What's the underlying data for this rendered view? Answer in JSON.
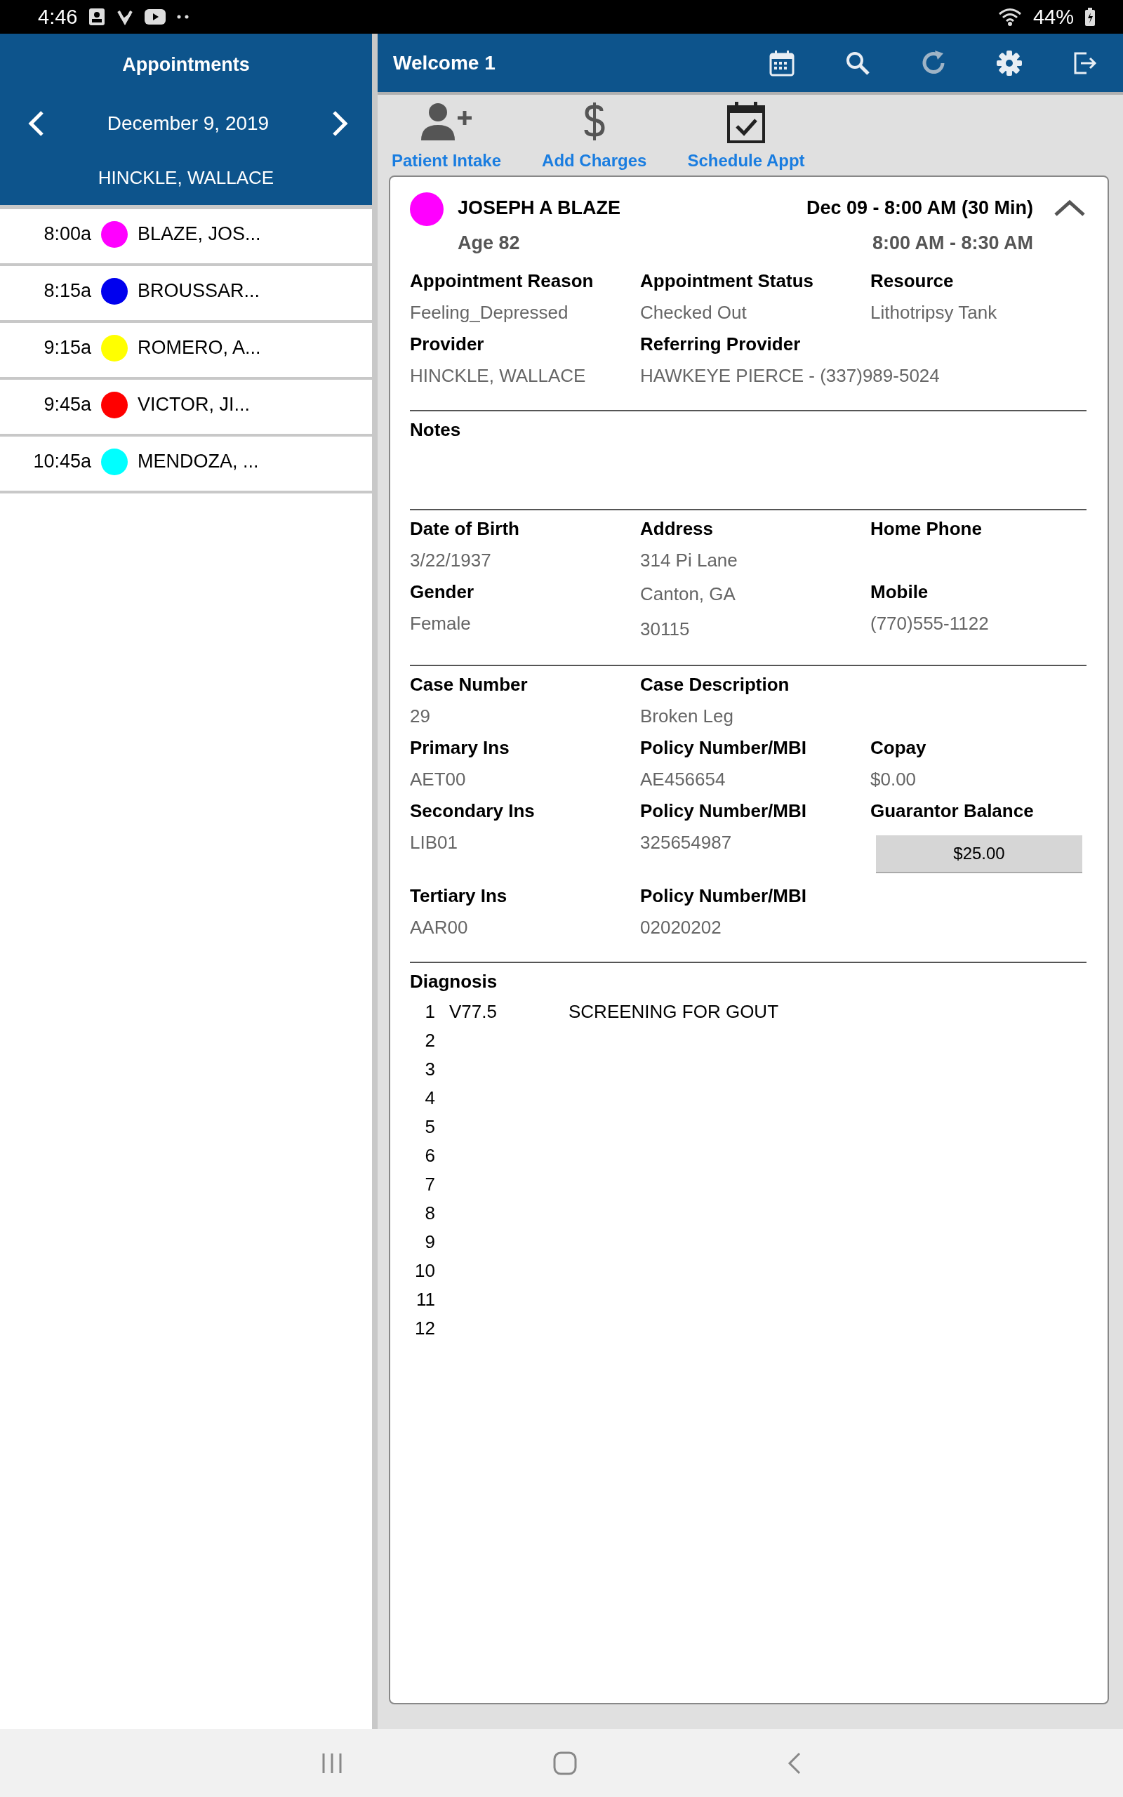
{
  "status_bar": {
    "time": "4:46",
    "battery": "44%"
  },
  "left_panel": {
    "title": "Appointments",
    "date": "December 9, 2019",
    "provider": "HINCKLE, WALLACE",
    "appointments": [
      {
        "time": "8:00a",
        "name": "BLAZE, JOS...",
        "color": "#ff00ff"
      },
      {
        "time": "8:15a",
        "name": "BROUSSAR...",
        "color": "#0000ee"
      },
      {
        "time": "9:15a",
        "name": "ROMERO, A...",
        "color": "#ffff00"
      },
      {
        "time": "9:45a",
        "name": "VICTOR, JI...",
        "color": "#ff0000"
      },
      {
        "time": "10:45a",
        "name": "MENDOZA, ...",
        "color": "#00ffff"
      }
    ]
  },
  "header": {
    "title": "Welcome 1"
  },
  "actions": [
    {
      "label": "Patient Intake"
    },
    {
      "label": "Add Charges"
    },
    {
      "label": "Schedule Appt"
    }
  ],
  "card": {
    "patient_name": "JOSEPH A BLAZE",
    "color": "#ff00ff",
    "age": "Age 82",
    "date_line": "Dec 09 - 8:00 AM (30 Min)",
    "time_range": "8:00 AM - 8:30 AM",
    "expanded": true,
    "sections": [
      {
        "kind": "rows",
        "rows": [
          [
            {
              "label": "Appointment Reason",
              "values": [
                "Feeling_Depressed"
              ]
            },
            {
              "label": "Appointment Status",
              "values": [
                "Checked Out"
              ]
            },
            {
              "label": "Resource",
              "values": [
                "Lithotripsy Tank"
              ]
            }
          ],
          [
            {
              "label": "Provider",
              "values": [
                "HINCKLE, WALLACE"
              ]
            },
            {
              "label": "Referring Provider",
              "values": [
                "HAWKEYE PIERCE - (337)989-5024"
              ]
            },
            null
          ]
        ]
      },
      {
        "kind": "notes",
        "label": "Notes"
      },
      {
        "kind": "columns",
        "columns": [
          [
            {
              "label": "Date of Birth",
              "values": [
                "3/22/1937"
              ]
            },
            {
              "label": "Gender",
              "values": [
                "Female"
              ]
            }
          ],
          [
            {
              "label": "Address",
              "values": [
                "314 Pi Lane",
                "Canton, GA",
                "30115"
              ]
            }
          ],
          [
            {
              "label": "Home Phone"
            },
            {
              "label": "Mobile",
              "values": [
                "(770)555-1122"
              ]
            }
          ]
        ]
      },
      {
        "kind": "rows",
        "rows": [
          [
            {
              "label": "Case Number",
              "values": [
                "29"
              ]
            },
            {
              "label": "Case Description",
              "values": [
                "Broken Leg"
              ]
            },
            null
          ],
          [
            {
              "label": "Primary Ins",
              "values": [
                "AET00"
              ]
            },
            {
              "label": "Policy Number/MBI",
              "values": [
                "AE456654"
              ]
            },
            {
              "label": "Copay",
              "values": [
                "$0.00"
              ]
            }
          ],
          [
            {
              "label": "Secondary Ins",
              "values": [
                "LIB01"
              ]
            },
            {
              "label": "Policy Number/MBI",
              "values": [
                "325654987"
              ]
            },
            {
              "label": "Guarantor Balance",
              "button": "$25.00"
            }
          ],
          [
            {
              "label": "Tertiary Ins",
              "values": [
                "AAR00"
              ]
            },
            {
              "label": "Policy Number/MBI",
              "values": [
                "02020202"
              ]
            },
            null
          ]
        ]
      },
      {
        "kind": "diagnosis",
        "label": "Diagnosis",
        "items": [
          {
            "number": "1",
            "code": "V77.5",
            "description": "SCREENING FOR GOUT"
          },
          {
            "number": "2"
          },
          {
            "number": "3"
          },
          {
            "number": "4"
          },
          {
            "number": "5"
          },
          {
            "number": "6"
          },
          {
            "number": "7"
          },
          {
            "number": "8"
          },
          {
            "number": "9"
          },
          {
            "number": "10"
          },
          {
            "number": "11"
          },
          {
            "number": "12"
          }
        ]
      }
    ]
  }
}
